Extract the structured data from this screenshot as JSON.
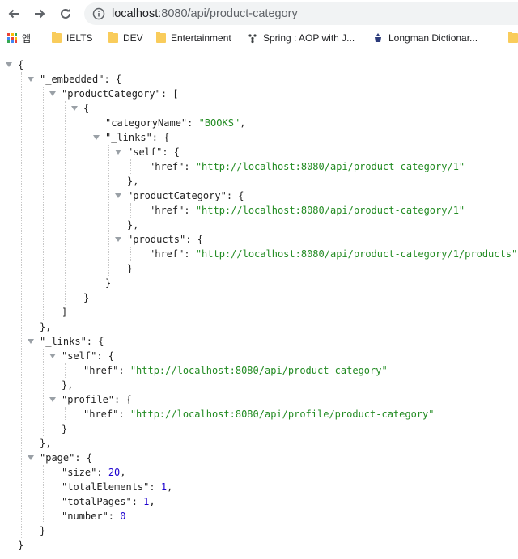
{
  "browser": {
    "url_host": "localhost",
    "url_path": ":8080/api/product-category",
    "bookmarks": [
      {
        "label": "앱",
        "icon": "apps-grid-icon"
      },
      {
        "label": "IELTS",
        "icon": "folder-icon"
      },
      {
        "label": "DEV",
        "icon": "folder-icon"
      },
      {
        "label": "Entertainment",
        "icon": "folder-icon"
      },
      {
        "label": "Spring : AOP with J...",
        "icon": "spring-logo-icon"
      },
      {
        "label": "Longman Dictionar...",
        "icon": "longman-logo-icon"
      }
    ]
  },
  "json_lines": [
    {
      "indent": 0,
      "tri": true,
      "parts": [
        [
          "p",
          "{"
        ]
      ]
    },
    {
      "indent": 1,
      "tri": true,
      "parts": [
        [
          "k",
          "\"_embedded\""
        ],
        [
          "p",
          ": {"
        ]
      ]
    },
    {
      "indent": 2,
      "tri": true,
      "parts": [
        [
          "k",
          "\"productCategory\""
        ],
        [
          "p",
          ": ["
        ]
      ]
    },
    {
      "indent": 3,
      "tri": true,
      "parts": [
        [
          "p",
          "{"
        ]
      ]
    },
    {
      "indent": 4,
      "tri": false,
      "parts": [
        [
          "k",
          "\"categoryName\""
        ],
        [
          "p",
          ": "
        ],
        [
          "str",
          "\"BOOKS\""
        ],
        [
          "p",
          ","
        ]
      ]
    },
    {
      "indent": 4,
      "tri": true,
      "parts": [
        [
          "k",
          "\"_links\""
        ],
        [
          "p",
          ": {"
        ]
      ]
    },
    {
      "indent": 5,
      "tri": true,
      "parts": [
        [
          "k",
          "\"self\""
        ],
        [
          "p",
          ": {"
        ]
      ]
    },
    {
      "indent": 6,
      "tri": false,
      "parts": [
        [
          "k",
          "\"href\""
        ],
        [
          "p",
          ": "
        ],
        [
          "str",
          "\"http://localhost:8080/api/product-category/1\""
        ]
      ]
    },
    {
      "indent": 5,
      "tri": false,
      "parts": [
        [
          "p",
          "},"
        ]
      ]
    },
    {
      "indent": 5,
      "tri": true,
      "parts": [
        [
          "k",
          "\"productCategory\""
        ],
        [
          "p",
          ": {"
        ]
      ]
    },
    {
      "indent": 6,
      "tri": false,
      "parts": [
        [
          "k",
          "\"href\""
        ],
        [
          "p",
          ": "
        ],
        [
          "str",
          "\"http://localhost:8080/api/product-category/1\""
        ]
      ]
    },
    {
      "indent": 5,
      "tri": false,
      "parts": [
        [
          "p",
          "},"
        ]
      ]
    },
    {
      "indent": 5,
      "tri": true,
      "parts": [
        [
          "k",
          "\"products\""
        ],
        [
          "p",
          ": {"
        ]
      ]
    },
    {
      "indent": 6,
      "tri": false,
      "parts": [
        [
          "k",
          "\"href\""
        ],
        [
          "p",
          ": "
        ],
        [
          "str",
          "\"http://localhost:8080/api/product-category/1/products\""
        ]
      ]
    },
    {
      "indent": 5,
      "tri": false,
      "parts": [
        [
          "p",
          "}"
        ]
      ]
    },
    {
      "indent": 4,
      "tri": false,
      "parts": [
        [
          "p",
          "}"
        ]
      ]
    },
    {
      "indent": 3,
      "tri": false,
      "parts": [
        [
          "p",
          "}"
        ]
      ]
    },
    {
      "indent": 2,
      "tri": false,
      "parts": [
        [
          "p",
          "]"
        ]
      ]
    },
    {
      "indent": 1,
      "tri": false,
      "parts": [
        [
          "p",
          "},"
        ]
      ]
    },
    {
      "indent": 1,
      "tri": true,
      "parts": [
        [
          "k",
          "\"_links\""
        ],
        [
          "p",
          ": {"
        ]
      ]
    },
    {
      "indent": 2,
      "tri": true,
      "parts": [
        [
          "k",
          "\"self\""
        ],
        [
          "p",
          ": {"
        ]
      ]
    },
    {
      "indent": 3,
      "tri": false,
      "parts": [
        [
          "k",
          "\"href\""
        ],
        [
          "p",
          ": "
        ],
        [
          "str",
          "\"http://localhost:8080/api/product-category\""
        ]
      ]
    },
    {
      "indent": 2,
      "tri": false,
      "parts": [
        [
          "p",
          "},"
        ]
      ]
    },
    {
      "indent": 2,
      "tri": true,
      "parts": [
        [
          "k",
          "\"profile\""
        ],
        [
          "p",
          ": {"
        ]
      ]
    },
    {
      "indent": 3,
      "tri": false,
      "parts": [
        [
          "k",
          "\"href\""
        ],
        [
          "p",
          ": "
        ],
        [
          "str",
          "\"http://localhost:8080/api/profile/product-category\""
        ]
      ]
    },
    {
      "indent": 2,
      "tri": false,
      "parts": [
        [
          "p",
          "}"
        ]
      ]
    },
    {
      "indent": 1,
      "tri": false,
      "parts": [
        [
          "p",
          "},"
        ]
      ]
    },
    {
      "indent": 1,
      "tri": true,
      "parts": [
        [
          "k",
          "\"page\""
        ],
        [
          "p",
          ": {"
        ]
      ]
    },
    {
      "indent": 2,
      "tri": false,
      "parts": [
        [
          "k",
          "\"size\""
        ],
        [
          "p",
          ": "
        ],
        [
          "num",
          "20"
        ],
        [
          "p",
          ","
        ]
      ]
    },
    {
      "indent": 2,
      "tri": false,
      "parts": [
        [
          "k",
          "\"totalElements\""
        ],
        [
          "p",
          ": "
        ],
        [
          "num",
          "1"
        ],
        [
          "p",
          ","
        ]
      ]
    },
    {
      "indent": 2,
      "tri": false,
      "parts": [
        [
          "k",
          "\"totalPages\""
        ],
        [
          "p",
          ": "
        ],
        [
          "num",
          "1"
        ],
        [
          "p",
          ","
        ]
      ]
    },
    {
      "indent": 2,
      "tri": false,
      "parts": [
        [
          "k",
          "\"number\""
        ],
        [
          "p",
          ": "
        ],
        [
          "num",
          "0"
        ]
      ]
    },
    {
      "indent": 1,
      "tri": false,
      "parts": [
        [
          "p",
          "}"
        ]
      ]
    },
    {
      "indent": 0,
      "tri": false,
      "parts": [
        [
          "p",
          "}"
        ]
      ]
    }
  ]
}
